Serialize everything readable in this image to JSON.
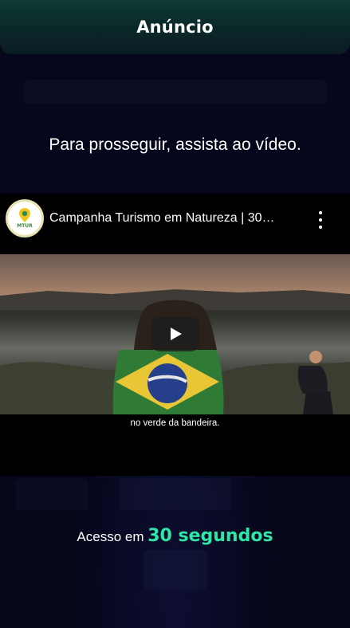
{
  "header": {
    "title": "Anúncio"
  },
  "prompt": {
    "text": "Para prosseguir, assista ao vídeo."
  },
  "video": {
    "channel_icon": "mtur-logo-icon",
    "channel_short": "MTUR",
    "title": "Campanha Turismo em Natureza | 30…",
    "menu_icon": "more-vertical-icon",
    "play_icon": "play-icon",
    "caption": "no verde da bandeira."
  },
  "countdown": {
    "label": "Acesso em ",
    "value": "30 segundos",
    "accent_color": "#2ee6a6"
  },
  "colors": {
    "background": "#05061a",
    "header_top": "#0e3a34",
    "header_bottom": "#0a1c22"
  }
}
